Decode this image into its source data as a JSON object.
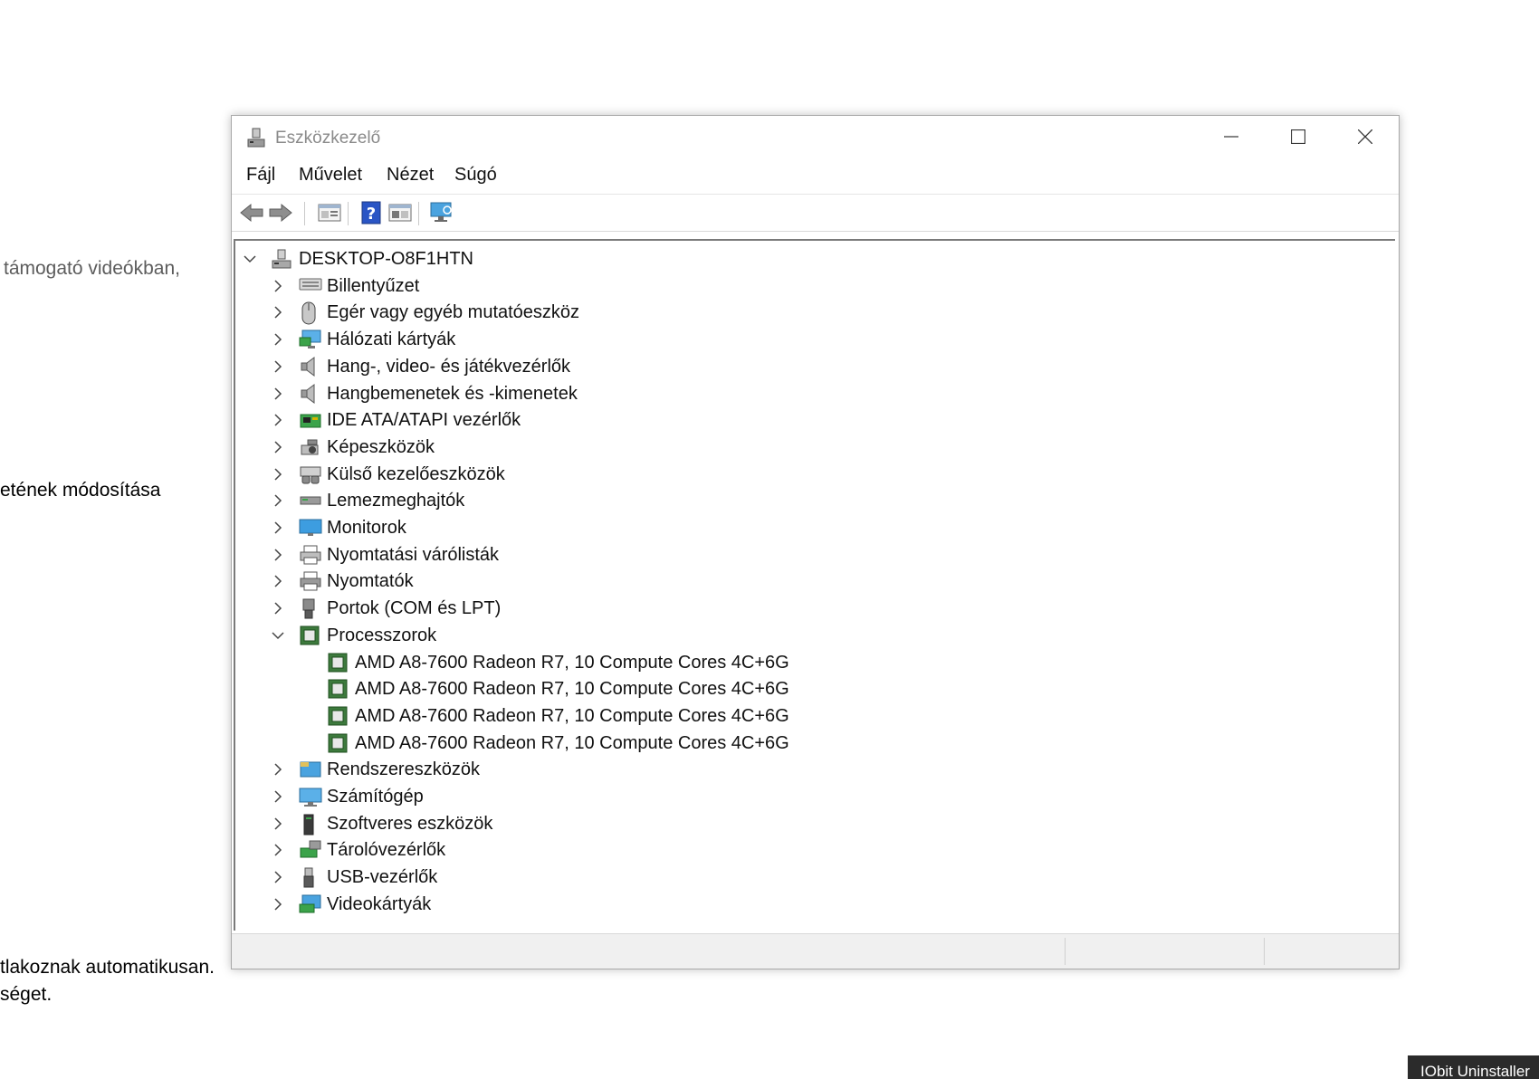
{
  "background": {
    "text1": "támogató videókban,",
    "text2": "etének módosítása",
    "text3": "tlakoznak automatikusan.",
    "text4": "séget.",
    "taskbar_tip": "IObit Uninstaller"
  },
  "window": {
    "title": "Eszközkezelő",
    "menu": [
      "Fájl",
      "Művelet",
      "Nézet",
      "Súgó"
    ]
  },
  "tree": {
    "root": "DESKTOP-O8F1HTN",
    "categories": [
      {
        "label": "Billentyűzet",
        "icon": "keyboard-icon"
      },
      {
        "label": "Egér vagy egyéb mutatóeszköz",
        "icon": "mouse-icon"
      },
      {
        "label": "Hálózati kártyák",
        "icon": "network-adapter-icon"
      },
      {
        "label": "Hang-, video- és játékvezérlők",
        "icon": "speaker-icon"
      },
      {
        "label": "Hangbemenetek és -kimenetek",
        "icon": "speaker-icon"
      },
      {
        "label": "IDE ATA/ATAPI vezérlők",
        "icon": "ide-controller-icon"
      },
      {
        "label": "Képeszközök",
        "icon": "camera-icon"
      },
      {
        "label": "Külső kezelőeszközök",
        "icon": "hid-icon"
      },
      {
        "label": "Lemezmeghajtók",
        "icon": "disk-drive-icon"
      },
      {
        "label": "Monitorok",
        "icon": "monitor-icon"
      },
      {
        "label": "Nyomtatási várólisták",
        "icon": "printer-queue-icon"
      },
      {
        "label": "Nyomtatók",
        "icon": "printer-icon"
      },
      {
        "label": "Portok (COM és LPT)",
        "icon": "port-icon"
      },
      {
        "label": "Processzorok",
        "icon": "processor-icon",
        "expanded": true,
        "children": [
          "AMD A8-7600 Radeon R7, 10 Compute Cores 4C+6G",
          "AMD A8-7600 Radeon R7, 10 Compute Cores 4C+6G",
          "AMD A8-7600 Radeon R7, 10 Compute Cores 4C+6G",
          "AMD A8-7600 Radeon R7, 10 Compute Cores 4C+6G"
        ]
      },
      {
        "label": "Rendszereszközök",
        "icon": "system-devices-icon"
      },
      {
        "label": "Számítógép",
        "icon": "computer-icon"
      },
      {
        "label": "Szoftveres eszközök",
        "icon": "software-device-icon"
      },
      {
        "label": "Tárolóvezérlők",
        "icon": "storage-controller-icon"
      },
      {
        "label": "USB-vezérlők",
        "icon": "usb-icon"
      },
      {
        "label": "Videokártyák",
        "icon": "display-adapter-icon"
      }
    ]
  }
}
